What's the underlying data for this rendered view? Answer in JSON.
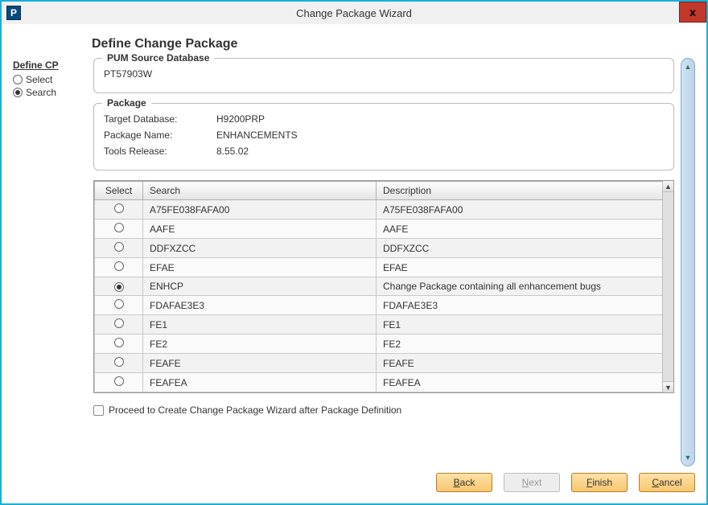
{
  "window": {
    "title": "Change Package Wizard",
    "app_icon_letter": "P",
    "close_glyph": "x"
  },
  "page_heading": "Define Change Package",
  "nav": {
    "title": "Define CP",
    "items": [
      {
        "label": "Select",
        "checked": false
      },
      {
        "label": "Search",
        "checked": true
      }
    ]
  },
  "source_panel": {
    "legend": "PUM Source Database",
    "value": "PT57903W"
  },
  "package_panel": {
    "legend": "Package",
    "rows": [
      {
        "k": "Target Database:",
        "v": "H9200PRP"
      },
      {
        "k": "Package Name:",
        "v": "ENHANCEMENTS"
      },
      {
        "k": "Tools Release:",
        "v": "8.55.02"
      }
    ]
  },
  "grid": {
    "headers": {
      "select": "Select",
      "search": "Search",
      "description": "Description"
    },
    "rows": [
      {
        "checked": false,
        "search": "A75FE038FAFA00",
        "description": "A75FE038FAFA00"
      },
      {
        "checked": false,
        "search": "AAFE",
        "description": "AAFE"
      },
      {
        "checked": false,
        "search": "DDFXZCC",
        "description": "DDFXZCC"
      },
      {
        "checked": false,
        "search": "EFAE",
        "description": "EFAE"
      },
      {
        "checked": true,
        "search": "ENHCP",
        "description": "Change Package containing all enhancement bugs"
      },
      {
        "checked": false,
        "search": "FDAFAE3E3",
        "description": "FDAFAE3E3"
      },
      {
        "checked": false,
        "search": "FE1",
        "description": "FE1"
      },
      {
        "checked": false,
        "search": "FE2",
        "description": "FE2"
      },
      {
        "checked": false,
        "search": "FEAFE",
        "description": "FEAFE"
      },
      {
        "checked": false,
        "search": "FEAFEA",
        "description": "FEAFEA"
      }
    ]
  },
  "proceed_checkbox": {
    "label": "Proceed to Create Change Package Wizard after Package Definition",
    "checked": false
  },
  "buttons": {
    "back": "Back",
    "next": "Next",
    "finish": "Finish",
    "cancel": "Cancel"
  }
}
